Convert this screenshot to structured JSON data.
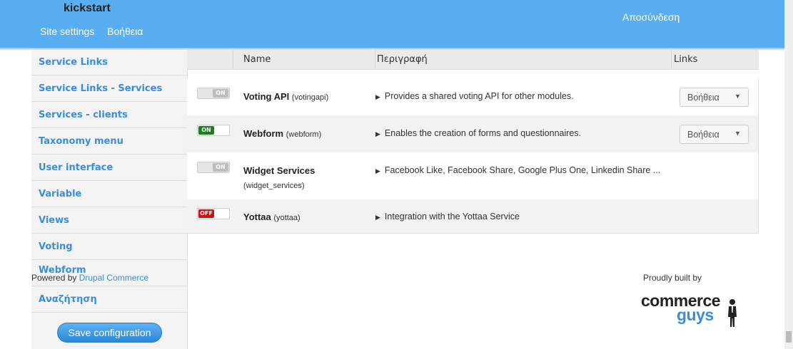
{
  "header": {
    "logo": "kickstart",
    "links": [
      "Site settings",
      "Βοήθεια"
    ],
    "logout": "Αποσύνδεση"
  },
  "sidebar": {
    "items": [
      "Service Links",
      "Service Links - Services",
      "Services - clients",
      "Taxonomy menu",
      "User interface",
      "Variable",
      "Views",
      "Voting",
      "Webform",
      "Αναζήτηση"
    ],
    "save_label": "Save configuration"
  },
  "table": {
    "headers": {
      "name": "Name",
      "description": "Περιγραφή",
      "links": "Links"
    },
    "rows": [
      {
        "toggle": "ON",
        "enabled": false,
        "name": "Voting API",
        "machine": "(votingapi)",
        "description": "Provides a shared voting API for other modules.",
        "help": "Βοήθεια"
      },
      {
        "toggle": "ON",
        "enabled": true,
        "name": "Webform",
        "machine": "(webform)",
        "description": "Enables the creation of forms and questionnaires.",
        "help": "Βοήθεια"
      },
      {
        "toggle": "ON",
        "enabled": false,
        "name": "Widget Services",
        "machine": "(widget_services)",
        "description": "Facebook Like, Facebook Share, Google Plus One, Linkedin Share ...",
        "help": ""
      },
      {
        "toggle": "OFF",
        "enabled": false,
        "name": "Yottaa",
        "machine": "(yottaa)",
        "description": "Integration with the Yottaa Service",
        "help": ""
      }
    ]
  },
  "footer": {
    "powered_prefix": "Powered by",
    "powered_link": "Drupal Commerce",
    "built_by": "Proudly built by",
    "logo_top": "commerce",
    "logo_bottom": "guys"
  },
  "colors": {
    "header_bg": "#58aef0",
    "link": "#3a8ed9",
    "toggle_on": "#1e7d1e",
    "toggle_off": "#cc1111"
  }
}
